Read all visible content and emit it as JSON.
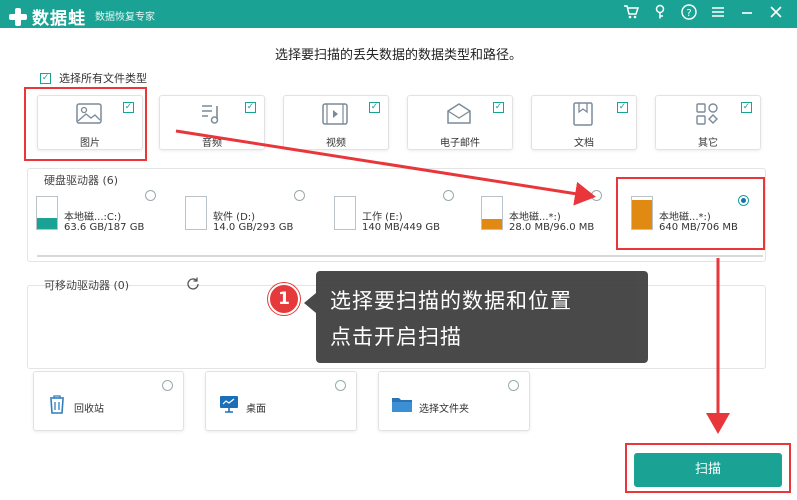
{
  "app": {
    "name": "数据蛙",
    "edition": "数据恢复专家",
    "titlebar_icons": [
      "cart-icon",
      "key-icon",
      "help-icon",
      "menu-icon",
      "minimize-icon",
      "close-icon"
    ]
  },
  "instruction": "选择要扫描的丢失数据的数据类型和路径。",
  "select_all": {
    "label": "选择所有文件类型",
    "checked": true
  },
  "file_types": [
    {
      "label": "图片",
      "icon": "image-icon",
      "checked": true
    },
    {
      "label": "音频",
      "icon": "audio-icon",
      "checked": true
    },
    {
      "label": "视频",
      "icon": "video-icon",
      "checked": true
    },
    {
      "label": "电子邮件",
      "icon": "email-icon",
      "checked": true
    },
    {
      "label": "文档",
      "icon": "document-icon",
      "checked": true
    },
    {
      "label": "其它",
      "icon": "other-icon",
      "checked": true
    }
  ],
  "hard_drives": {
    "label": "硬盘驱动器 (6)",
    "items": [
      {
        "name": "本地磁...:C:)",
        "size": "63.6 GB/187 GB",
        "selected": false
      },
      {
        "name": "软件 (D:)",
        "size": "14.0 GB/293 GB",
        "selected": false
      },
      {
        "name": "工作 (E:)",
        "size": "140 MB/449 GB",
        "selected": false
      },
      {
        "name": "本地磁...*:)",
        "size": "28.0 MB/96.0 MB",
        "selected": false
      },
      {
        "name": "本地磁...*:)",
        "size": "640 MB/706 MB",
        "selected": true
      }
    ]
  },
  "removable": {
    "label": "可移动驱动器 (0)"
  },
  "locations": [
    {
      "label": "回收站",
      "icon": "recycle-bin-icon"
    },
    {
      "label": "桌面",
      "icon": "desktop-icon"
    },
    {
      "label": "选择文件夹",
      "icon": "folder-icon"
    }
  ],
  "tooltip": {
    "step": "1",
    "line1": "选择要扫描的数据和位置",
    "line2": "点击开启扫描"
  },
  "scan_button": "扫描",
  "colors": {
    "accent": "#1aa394",
    "highlight": "#e8363a",
    "drive_fill": "#e08a14",
    "tooltip_bg": "#3c3c3c"
  }
}
